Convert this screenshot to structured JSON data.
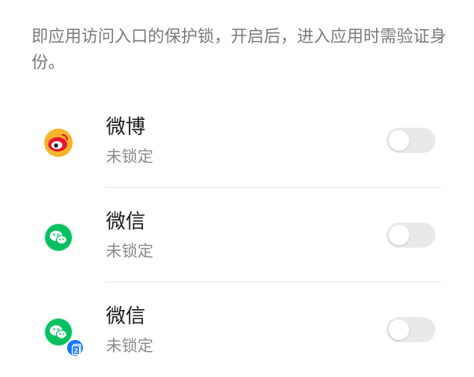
{
  "description": "即应用访问入口的保护锁，开启后，进入应用时需验证身份。",
  "apps": [
    {
      "name": "微博",
      "status": "未锁定",
      "icon": "weibo-icon",
      "locked": false
    },
    {
      "name": "微信",
      "status": "未锁定",
      "icon": "wechat-icon",
      "locked": false
    },
    {
      "name": "微信",
      "status": "未锁定",
      "icon": "wechat-clone-icon",
      "locked": false,
      "clone_badge": "2"
    }
  ],
  "colors": {
    "weibo": "#e6162d",
    "wechat": "#07c160",
    "clone_badge": "#1677ff",
    "toggle_off": "#e9e9e9"
  }
}
